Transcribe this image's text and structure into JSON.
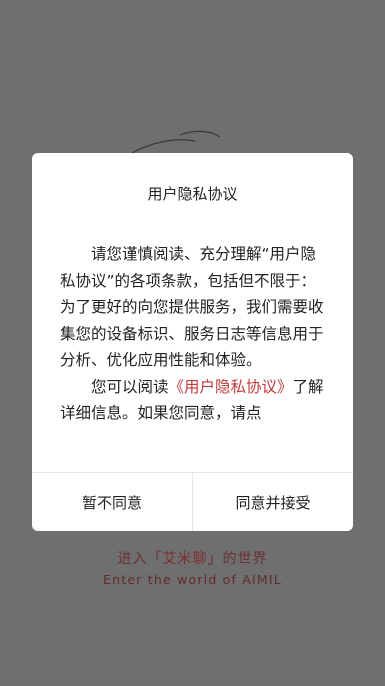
{
  "splash": {
    "tagline_prefix": "进入",
    "brand_open": "「",
    "brand": "艾米聊",
    "brand_close": "」",
    "tagline_suffix": "的世界",
    "tagline_en": "Enter the world of AIMIL"
  },
  "dialog": {
    "title": "用户隐私协议",
    "paragraph_1": "请您谨慎阅读、充分理解“用户隐私协议”的各项条款，包括但不限于：为了更好的向您提供服务，我们需要收集您的设备标识、服务日志等信息用于分析、优化应用性能和体验。",
    "paragraph_2_before": "您可以阅读",
    "paragraph_2_link": "《用户隐私协议》",
    "paragraph_2_after": "了解详细信息。如果您同意，请点",
    "decline_label": "暂不同意",
    "accept_label": "同意并接受"
  },
  "colors": {
    "backdrop": "#6f6f6f",
    "link": "#c0393b",
    "brand_text": "#6a3036"
  }
}
